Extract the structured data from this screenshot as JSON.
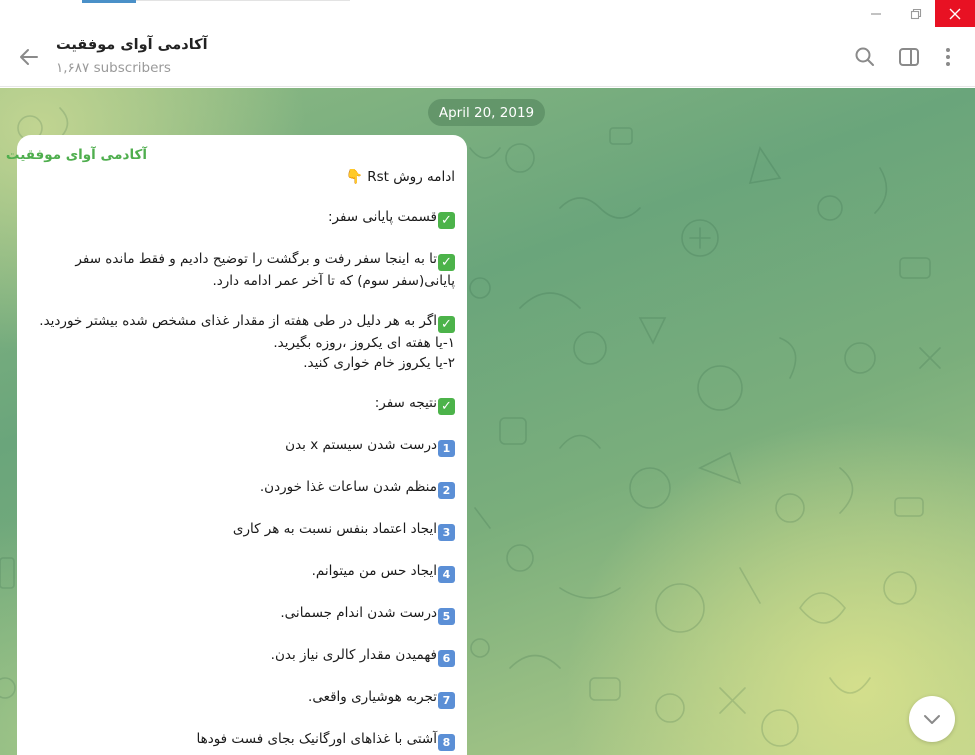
{
  "window": {
    "minimize_glyph": "—",
    "maximize_glyph": "❐",
    "close_glyph": "✕"
  },
  "header": {
    "title": "آکادمی آوای موفقیت",
    "subscribers": "۱,۶۸۷ subscribers",
    "icons": [
      "back-arrow-icon",
      "search-icon",
      "sidebar-panel-icon",
      "more-vertical-icon"
    ]
  },
  "chat": {
    "date": "April 20, 2019",
    "message": {
      "author": "آکادمی آوای موفقیت",
      "intro": "ادامه روش Rst",
      "section1_title": "قسمت پایانی سفر:",
      "para1": "تا به اینجا سفر رفت و برگشت را توضیح دادیم و فقط مانده سفر پایانی(سفر سوم) که تا آخر عمر ادامه دارد.",
      "para2_line1": "اگر به هر دلیل در طی هفته از مقدار غذای مشخص شده بیشتر خوردید.",
      "para2_line2": "۱-یا هفته ای یکروز ،روزه بگیرید.",
      "para2_line3": "۲-یا یکروز خام خواری کنید.",
      "section2_title": "نتیجه سفر:",
      "items": [
        {
          "num": "1",
          "text": "درست شدن سیستم x بدن"
        },
        {
          "num": "2",
          "text": "منظم شدن ساعات غذا خوردن."
        },
        {
          "num": "3",
          "text": "ایجاد اعتماد بنفس نسبت به هر کاری"
        },
        {
          "num": "4",
          "text": "ایجاد حس من میتوانم."
        },
        {
          "num": "5",
          "text": "درست شدن اندام جسمانی."
        },
        {
          "num": "6",
          "text": "فهمیدن مقدار کالری نیاز بدن."
        },
        {
          "num": "7",
          "text": "تجربه هوشیاری واقعی."
        },
        {
          "num": "8",
          "text": "آشتی با غذاهای اورگانیک بجای فست فودها"
        }
      ]
    }
  },
  "colors": {
    "accent_green": "#4fae4e",
    "close_red": "#e81123",
    "check_green": "#4cb34a",
    "number_blue": "#5b8fd6"
  }
}
